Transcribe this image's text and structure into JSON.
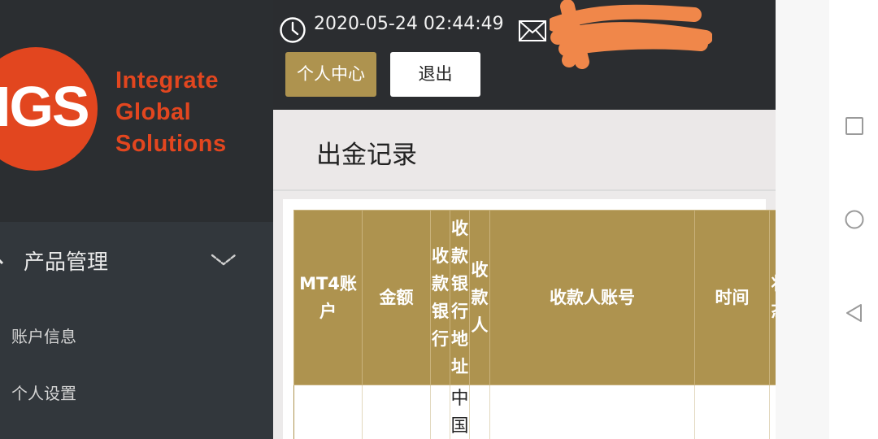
{
  "logo": {
    "letters": "IGS",
    "text_lines": [
      "Integrate",
      "Global",
      "Solutions"
    ],
    "brand_color": "#e2461f"
  },
  "sidebar": {
    "group_label": "产品管理",
    "group_icon": "chevron-down-icon",
    "items": [
      {
        "label": "账户信息"
      },
      {
        "label": "个人设置"
      }
    ]
  },
  "header": {
    "datetime": "2020-05-24 02:44:49",
    "clock_icon": "clock-icon",
    "mail_icon": "mail-icon",
    "profile_button": "个人中心",
    "logout_button": "退出",
    "accent_color": "#ae934f"
  },
  "page": {
    "title": "出金记录"
  },
  "table": {
    "columns": [
      {
        "label": "MT4账户"
      },
      {
        "label": "金额"
      },
      {
        "label": "收款银行"
      },
      {
        "label": "收款银行地址"
      },
      {
        "label": "收款人"
      },
      {
        "label": "收款人账号"
      },
      {
        "label": "时间"
      },
      {
        "label": "状态"
      }
    ],
    "rows": [
      {
        "bank_address": "中国"
      }
    ]
  },
  "navbar": {
    "icons": [
      "recent-apps-icon",
      "home-icon",
      "back-icon"
    ]
  }
}
